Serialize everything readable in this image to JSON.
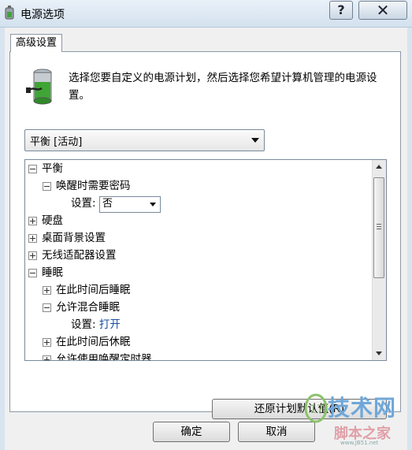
{
  "window": {
    "title": "电源选项",
    "help_glyph": "?",
    "close_glyph": "✕"
  },
  "tab": {
    "label": "高级设置"
  },
  "description": "选择您要自定义的电源计划，然后选择您希望计算机管理的电源设置。",
  "plan_select": {
    "value": "平衡 [活动]"
  },
  "tree": {
    "items": [
      {
        "label": "平衡",
        "expander": "minus"
      },
      {
        "label": "唤醒时需要密码",
        "expander": "minus"
      },
      {
        "label": "设置:",
        "value": "否"
      },
      {
        "label": "硬盘",
        "expander": "plus"
      },
      {
        "label": "桌面背景设置",
        "expander": "plus"
      },
      {
        "label": "无线适配器设置",
        "expander": "plus"
      },
      {
        "label": "睡眠",
        "expander": "minus"
      },
      {
        "label": "在此时间后睡眠",
        "expander": "plus"
      },
      {
        "label": "允许混合睡眠",
        "expander": "minus"
      },
      {
        "label": "设置:",
        "value": "打开"
      },
      {
        "label": "在此时间后休眠",
        "expander": "plus"
      },
      {
        "label": "允许使用唤醒定时器",
        "expander": "plus"
      }
    ]
  },
  "buttons": {
    "restore": "还原计划默认值(R)",
    "ok": "确定",
    "cancel": "取消"
  },
  "watermark": {
    "main": "技术网",
    "sub": "脚本之家",
    "url": "www.JB51.net"
  },
  "colors": {
    "link": "#1a4fa0",
    "battery": "#3fa535"
  }
}
